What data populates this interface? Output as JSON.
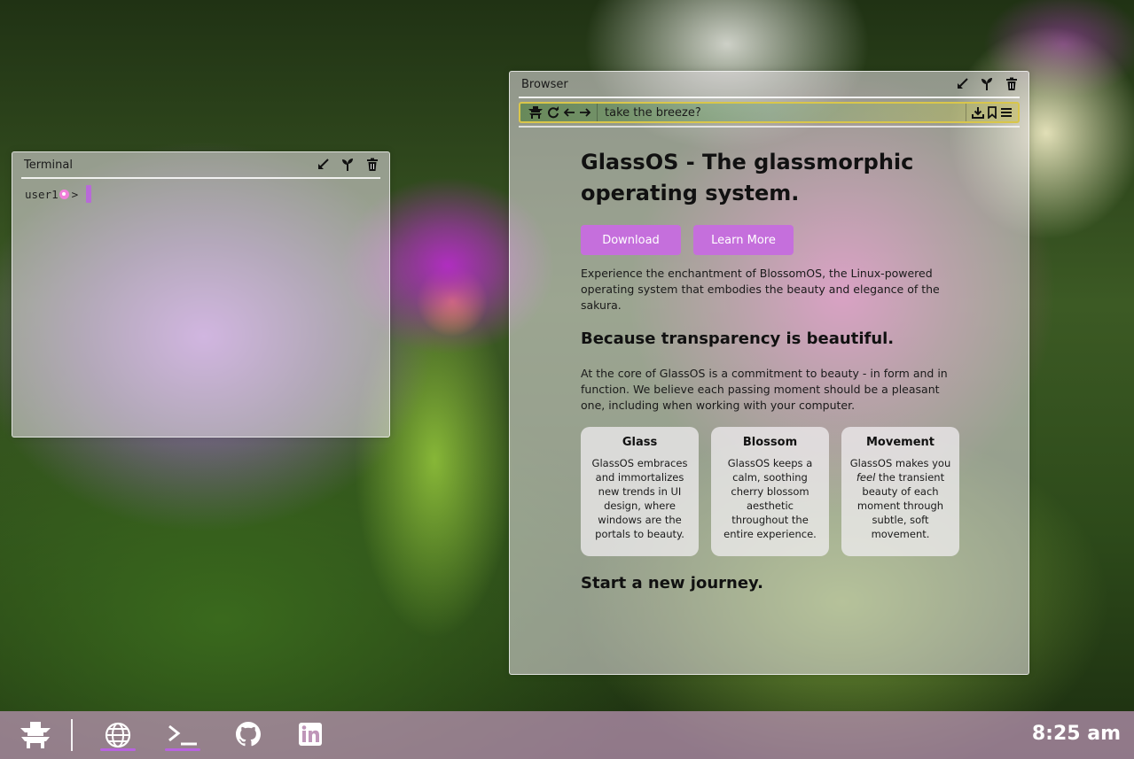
{
  "terminal": {
    "title": "Terminal",
    "prompt_user": "user1",
    "prompt_symbol": ">",
    "controls": [
      "minimize-icon",
      "sprout-icon",
      "trash-icon"
    ]
  },
  "browser": {
    "title": "Browser",
    "controls": [
      "minimize-icon",
      "sprout-icon",
      "trash-icon"
    ],
    "nav_icons": [
      "pagoda-icon",
      "reload-icon",
      "back-arrow-icon",
      "forward-arrow-icon"
    ],
    "address": "take the breeze?",
    "right_icons": [
      "download-icon",
      "bookmark-icon",
      "menu-icon"
    ]
  },
  "page": {
    "heading": "GlassOS - The glassmorphic operating system.",
    "download_label": "Download",
    "learn_more_label": "Learn More",
    "intro": "Experience the enchantment of BlossomOS, the Linux-powered operating system that embodies the beauty and elegance of the sakura.",
    "subheading": "Because transparency is beautiful.",
    "body": "At the core of GlassOS is a commitment to beauty - in form and in function. We believe each passing moment should be a pleasant one, including when working with your computer.",
    "cards": [
      {
        "title": "Glass",
        "text": "GlassOS embraces and immortalizes new trends in UI design, where windows are the portals to beauty."
      },
      {
        "title": "Blossom",
        "text": "GlassOS keeps a calm, soothing cherry blossom aesthetic throughout the entire experience."
      },
      {
        "title": "Movement",
        "text_before": "GlassOS makes you ",
        "text_em": "feel",
        "text_after": " the transient beauty of each moment through subtle, soft movement."
      }
    ],
    "footer_heading": "Start a new journey."
  },
  "taskbar": {
    "icons": [
      "pagoda-icon",
      "globe-icon",
      "terminal-icon",
      "github-icon",
      "linkedin-icon"
    ],
    "running": [
      "globe-icon",
      "terminal-icon"
    ],
    "clock": "8:25 am"
  },
  "colors": {
    "accent": "#c56fdc",
    "indicator": "#b863e0",
    "address_border": "#d9c64a",
    "prompt_flower": "#f07fd9"
  }
}
